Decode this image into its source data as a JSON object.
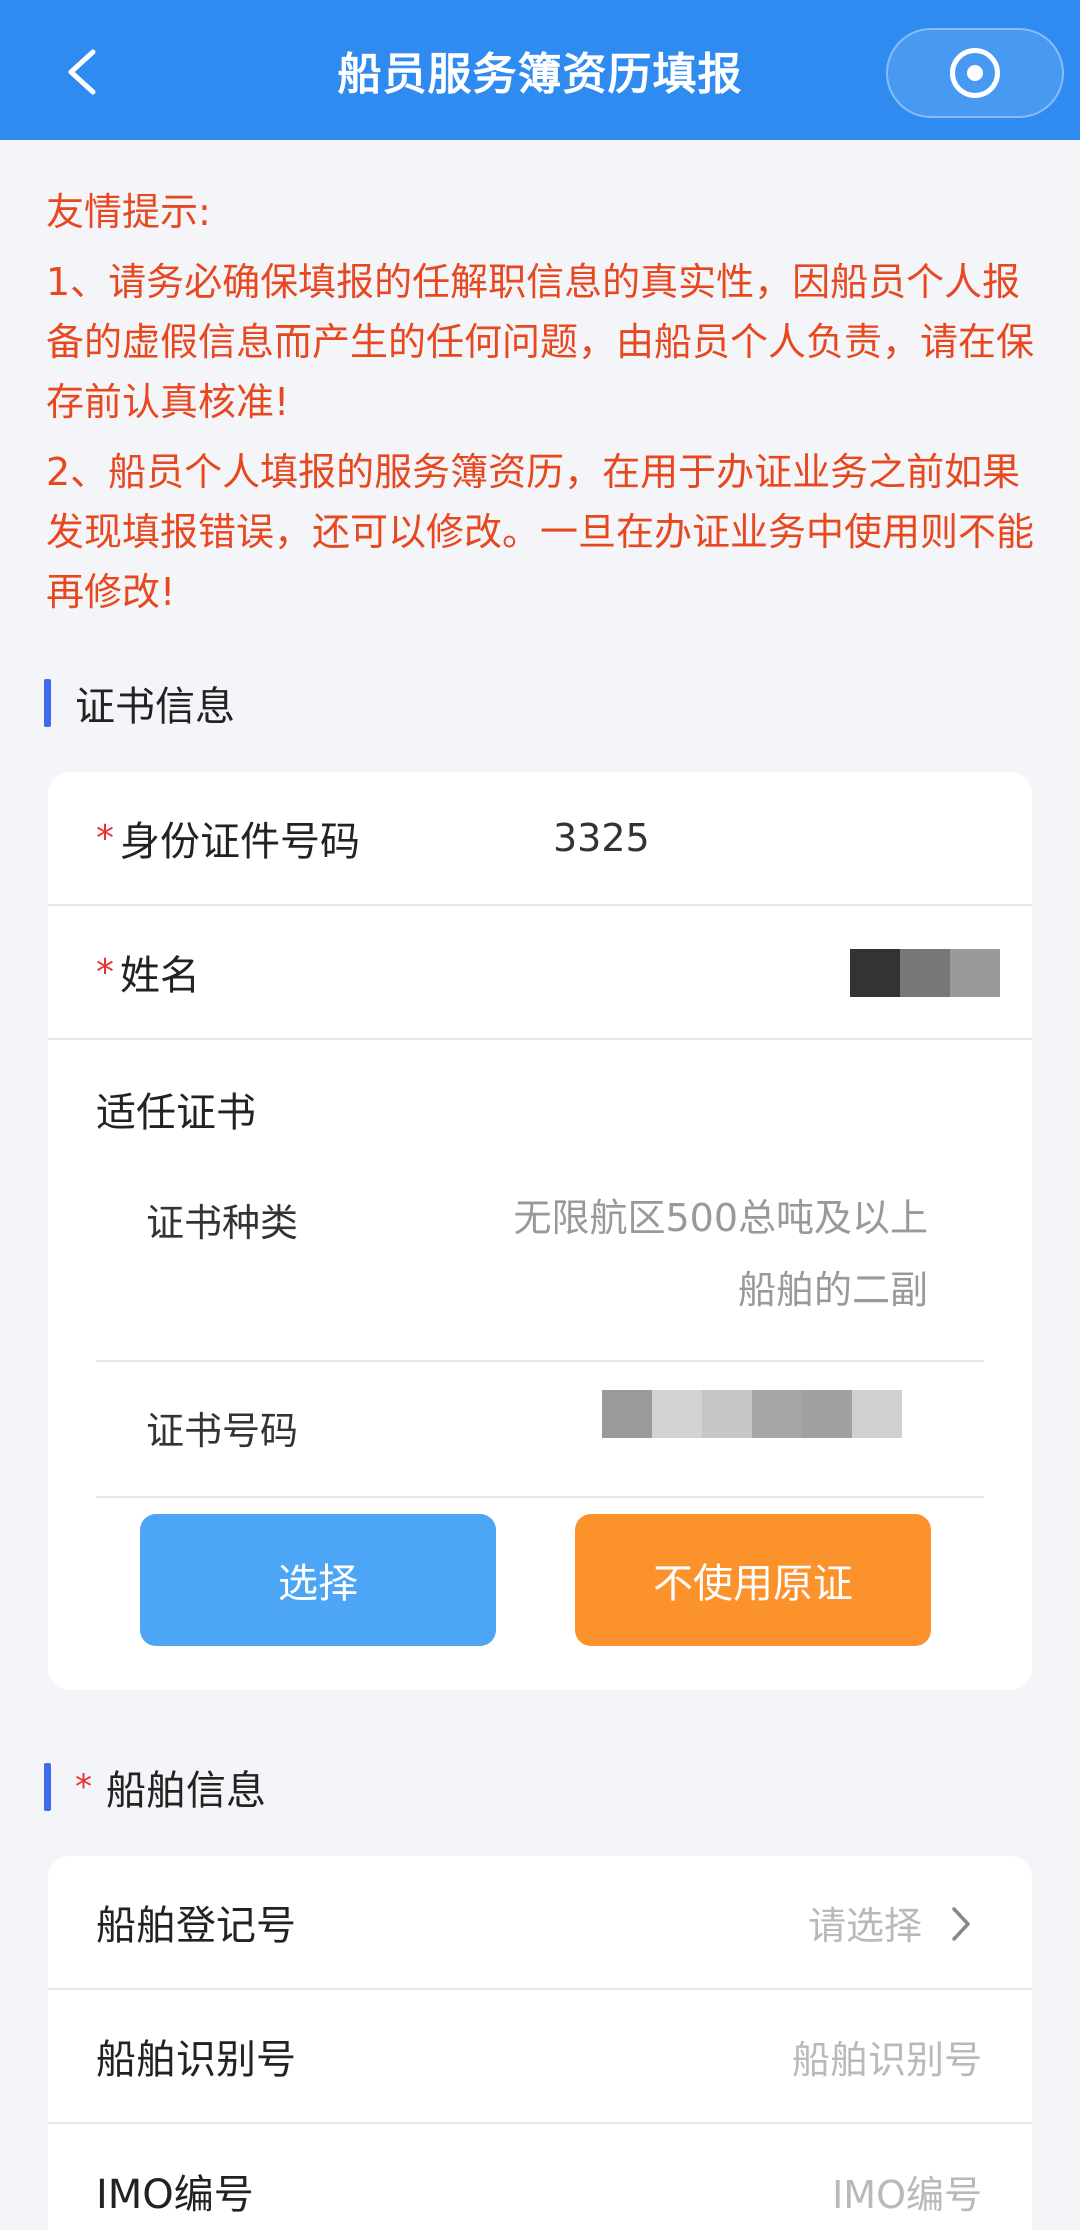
{
  "header": {
    "title": "船员服务簿资历填报",
    "colors": {
      "bar": "#2f8bf0"
    }
  },
  "tips": {
    "title": "友情提示:",
    "item1": "1、请务必确保填报的任解职信息的真实性，因船员个人报备的虚假信息而产生的任何问题，由船员个人负责，请在保存前认真核准!",
    "item2": "2、船员个人填报的服务簿资历，在用于办证业务之前如果发现填报错误，还可以修改。一旦在办证业务中使用则不能再修改!"
  },
  "cert_section": {
    "heading": "证书信息",
    "id_label": "身份证件号码",
    "id_value": "3325",
    "name_label": "姓名",
    "required_mark": "*",
    "cert_title": "适任证书",
    "cert_type_label": "证书种类",
    "cert_type_value": "无限航区500总吨及以上船舶的二副",
    "cert_no_label": "证书号码",
    "select_button": "选择",
    "no_original_button": "不使用原证"
  },
  "ship_section": {
    "required_mark": "*",
    "heading": "船舶信息",
    "reg_label": "船舶登记号",
    "reg_placeholder": "请选择",
    "ident_label": "船舶识别号",
    "ident_placeholder": "船舶识别号",
    "imo_label": "IMO编号",
    "imo_placeholder": "IMO编号"
  },
  "colors": {
    "tip_text": "#e8481f",
    "accent_bar": "#3f6bf0",
    "select_btn": "#4ca6f5",
    "orange_btn": "#fb922b"
  }
}
